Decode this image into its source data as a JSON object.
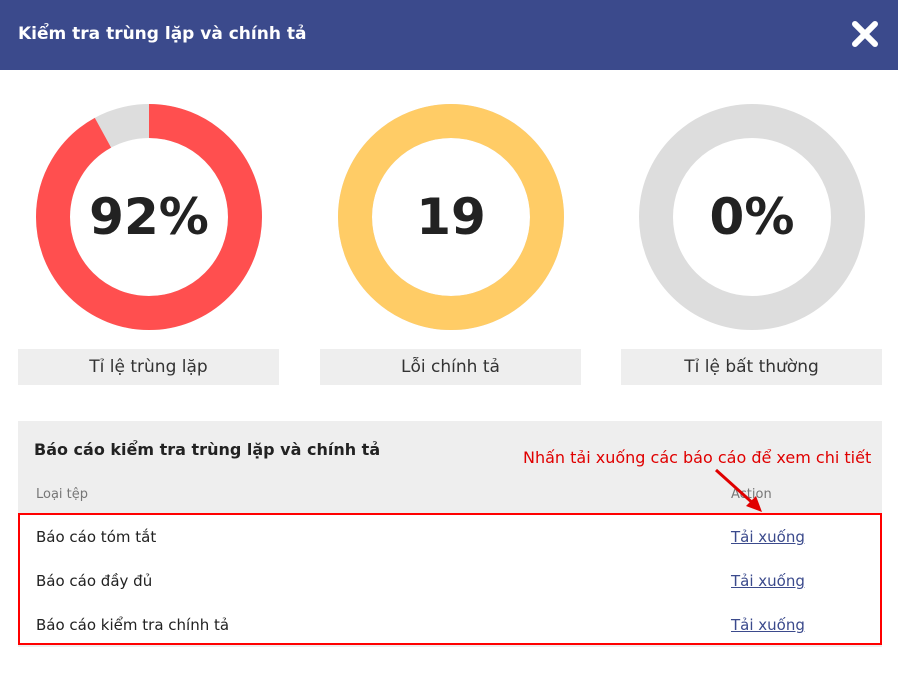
{
  "header": {
    "title": "Kiểm tra trùng lặp và chính tả"
  },
  "stats": [
    {
      "value": "92%",
      "label": "Tỉ lệ trùng lặp",
      "fraction": 0.92,
      "color": "#ff4f4f",
      "track_color": "#dddddd"
    },
    {
      "value": "19",
      "label": "Lỗi chính tả",
      "fraction": 1.0,
      "color": "#ffcc66",
      "track_color": "#dddddd"
    },
    {
      "value": "0%",
      "label": "Tỉ lệ bất thường",
      "fraction": 0.0,
      "color": "#ff4f4f",
      "track_color": "#dddddd"
    }
  ],
  "report": {
    "title": "Báo cáo kiểm tra trùng lặp và chính tả",
    "col_type": "Loại tệp",
    "col_action": "Action",
    "rows": [
      {
        "name": "Báo cáo tóm tắt",
        "action": "Tải xuống"
      },
      {
        "name": "Báo cáo đầy đủ",
        "action": "Tải xuống"
      },
      {
        "name": "Báo cáo kiểm tra chính tả",
        "action": "Tải xuống"
      }
    ]
  },
  "annotation": {
    "text": "Nhấn tải xuống các báo cáo để xem chi tiết",
    "color": "#e00000"
  },
  "colors": {
    "header_bg": "#3b4a8c",
    "panel_bg": "#eeeeee",
    "link": "#3b4a8c"
  }
}
